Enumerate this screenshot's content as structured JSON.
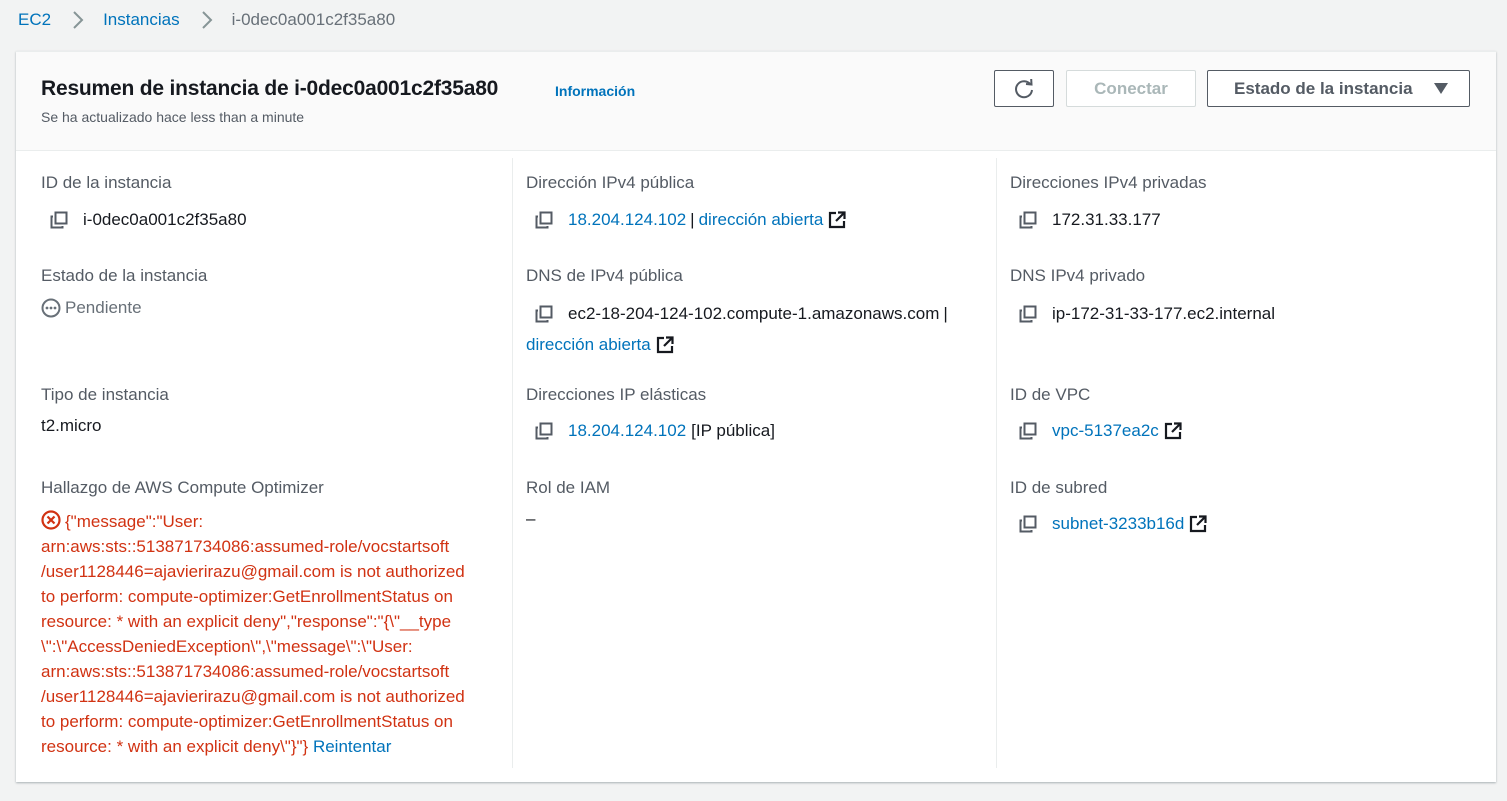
{
  "breadcrumb": {
    "root": "EC2",
    "instances": "Instancias",
    "current": "i-0dec0a001c2f35a80"
  },
  "header": {
    "title": "Resumen de instancia de i-0dec0a001c2f35a80",
    "info": "Información",
    "subtitle": "Se ha actualizado hace less than a minute",
    "connect": "Conectar",
    "instance_state": "Estado de la instancia"
  },
  "fields": {
    "instance_id_label": "ID de la instancia",
    "instance_id": "i-0dec0a001c2f35a80",
    "public_ipv4_label": "Dirección IPv4 pública",
    "public_ipv4": "18.204.124.102",
    "open_address": "dirección abierta",
    "private_ipv4_label": "Direcciones IPv4 privadas",
    "private_ipv4": "172.31.33.177",
    "state_label": "Estado de la instancia",
    "state": "Pendiente",
    "public_dns_label": "DNS de IPv4 pública",
    "public_dns": "ec2-18-204-124-102.compute-1.amazonaws.com",
    "private_dns_label": "DNS IPv4 privado",
    "private_dns": "ip-172-31-33-177.ec2.internal",
    "type_label": "Tipo de instancia",
    "type": "t2.micro",
    "elastic_ip_label": "Direcciones IP elásticas",
    "elastic_ip": "18.204.124.102",
    "elastic_ip_suffix": "[IP pública]",
    "vpc_label": "ID de VPC",
    "vpc": "vpc-5137ea2c",
    "optimizer_label": "Hallazgo de AWS Compute Optimizer",
    "optimizer_error_lines": [
      "{\"message\":\"User:",
      "arn:aws:sts::513871734086:assumed-role/vocstartsoft",
      "/user1128446=ajavierirazu@gmail.com is not authorized",
      "to perform: compute-optimizer:GetEnrollmentStatus on",
      "resource: * with an explicit deny\",\"response\":\"{\\\"__type",
      "\\\":\\\"AccessDeniedException\\\",\\\"message\\\":\\\"User:",
      "arn:aws:sts::513871734086:assumed-role/vocstartsoft",
      "/user1128446=ajavierirazu@gmail.com is not authorized",
      "to perform: compute-optimizer:GetEnrollmentStatus on",
      "resource: * with an explicit deny\\\"}\"}"
    ],
    "retry": "Reintentar",
    "iam_label": "Rol de IAM",
    "iam": "–",
    "subnet_label": "ID de subred",
    "subnet": "subnet-3233b16d"
  },
  "icons": {
    "copy": "copy-icon",
    "external": "external-link-icon",
    "refresh": "refresh-icon",
    "pending": "pending-icon",
    "error": "error-icon",
    "chevron": "chevron-right-icon",
    "caret": "caret-down-icon"
  },
  "colors": {
    "link": "#0073bb",
    "error": "#d13212",
    "muted": "#545b64",
    "page_bg": "#f2f3f3"
  }
}
